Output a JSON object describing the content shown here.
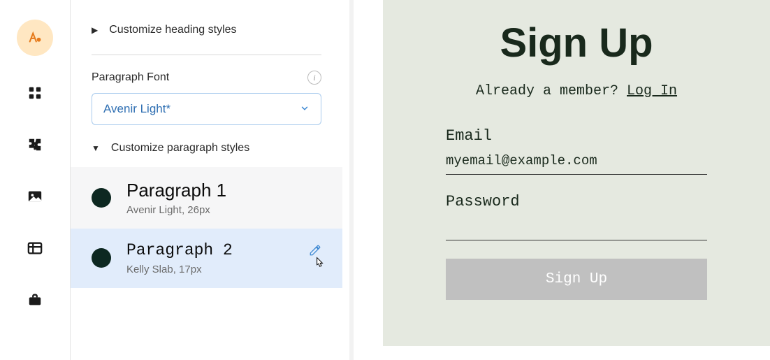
{
  "sidebar": {
    "items": [
      "fonts",
      "grid",
      "plugins",
      "image",
      "table",
      "briefcase"
    ]
  },
  "panel": {
    "heading_toggle": "Customize heading styles",
    "paragraph_font_label": "Paragraph Font",
    "font_select_value": "Avenir Light*",
    "paragraph_toggle": "Customize paragraph styles",
    "styles": [
      {
        "name": "Paragraph 1",
        "desc": "Avenir Light, 26px"
      },
      {
        "name": "Paragraph 2",
        "desc": "Kelly Slab, 17px"
      }
    ]
  },
  "preview": {
    "title": "Sign Up",
    "already_text": "Already a member? ",
    "login_text": "Log In",
    "email_label": "Email",
    "email_value": "myemail@example.com",
    "password_label": "Password",
    "password_value": "",
    "button_label": "Sign Up"
  },
  "colors": {
    "accent": "#3885d1",
    "preview_bg": "#e5e9e0",
    "dark_text": "#19291c",
    "selected_bg": "#e1ecfb",
    "brand_bg": "#ffe7c2"
  }
}
